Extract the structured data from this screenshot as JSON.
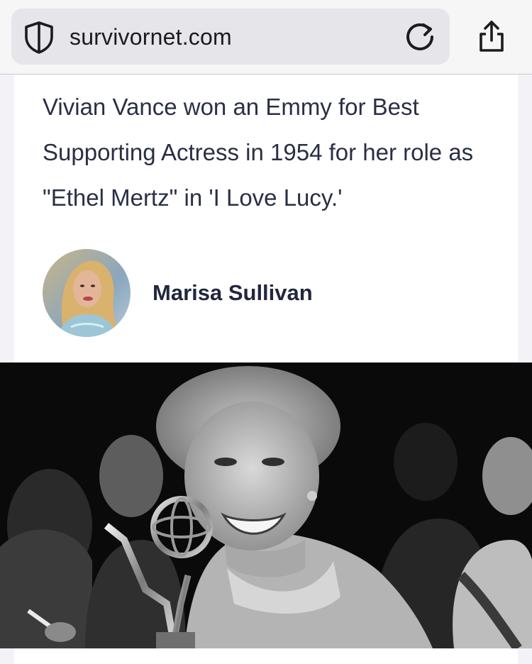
{
  "browser": {
    "url": "survivornet.com",
    "icons": {
      "site": "shield-icon",
      "reload": "reload-icon",
      "share": "share-icon"
    }
  },
  "article": {
    "caption": "Vivian Vance won an Emmy for Best Supporting Actress in 1954 for her role as \"Ethel Mertz\" in 'I Love Lucy.'",
    "author": {
      "name": "Marisa Sullivan"
    }
  },
  "colors": {
    "text": "#2a2f45",
    "author": "#22273d",
    "urlbar": "#e5e5ea"
  }
}
